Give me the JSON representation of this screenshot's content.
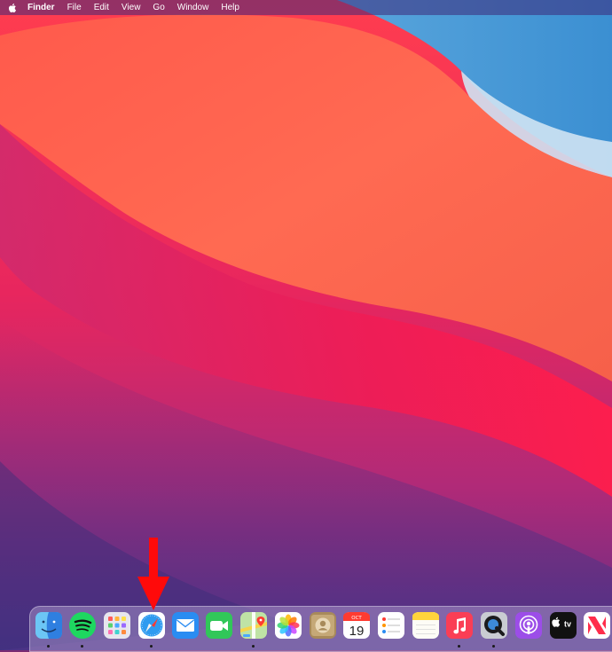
{
  "menubar": {
    "apple_icon": "apple-logo-icon",
    "items": [
      {
        "label": "Finder",
        "bold": true
      },
      {
        "label": "File"
      },
      {
        "label": "Edit"
      },
      {
        "label": "View"
      },
      {
        "label": "Go"
      },
      {
        "label": "Window"
      },
      {
        "label": "Help"
      }
    ]
  },
  "annotation": {
    "icon": "red-down-arrow-icon",
    "color": "#ff0a0a"
  },
  "dock": {
    "apps": [
      {
        "icon": "finder-icon",
        "running": true
      },
      {
        "icon": "spotify-icon",
        "running": true
      },
      {
        "icon": "launchpad-icon",
        "running": false
      },
      {
        "icon": "safari-icon",
        "running": true
      },
      {
        "icon": "mail-icon",
        "running": false
      },
      {
        "icon": "facetime-icon",
        "running": false
      },
      {
        "icon": "maps-icon",
        "running": true
      },
      {
        "icon": "photos-icon",
        "running": false
      },
      {
        "icon": "contacts-icon",
        "running": false
      },
      {
        "icon": "calendar-icon",
        "running": false,
        "month": "OCT",
        "day": "19"
      },
      {
        "icon": "reminders-icon",
        "running": false
      },
      {
        "icon": "notes-icon",
        "running": false
      },
      {
        "icon": "music-icon",
        "running": true
      },
      {
        "icon": "quicktime-icon",
        "running": true
      },
      {
        "icon": "podcasts-icon",
        "running": false
      },
      {
        "icon": "apple-tv-icon",
        "running": false,
        "label": "tv"
      },
      {
        "icon": "news-icon",
        "running": false
      }
    ]
  }
}
